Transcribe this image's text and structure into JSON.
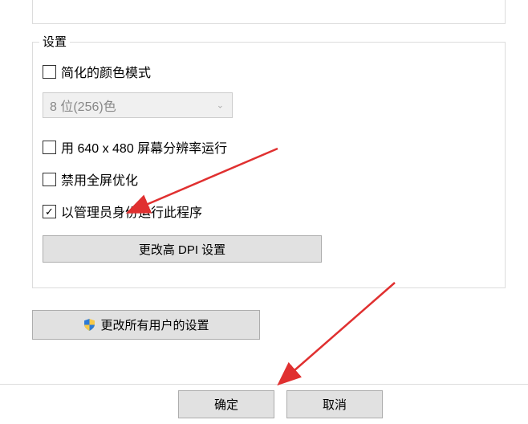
{
  "group": {
    "legend": "设置",
    "simplified_color_label": "简化的颜色模式",
    "color_dropdown_value": "8 位(256)色",
    "resolution_label": "用 640 x 480 屏幕分辨率运行",
    "disable_fullscreen_label": "禁用全屏优化",
    "run_as_admin_label": "以管理员身份运行此程序",
    "dpi_button_label": "更改高 DPI 设置"
  },
  "all_users_button_label": "更改所有用户的设置",
  "buttons": {
    "ok": "确定",
    "cancel": "取消"
  },
  "checkbox_checked_glyph": "✓"
}
